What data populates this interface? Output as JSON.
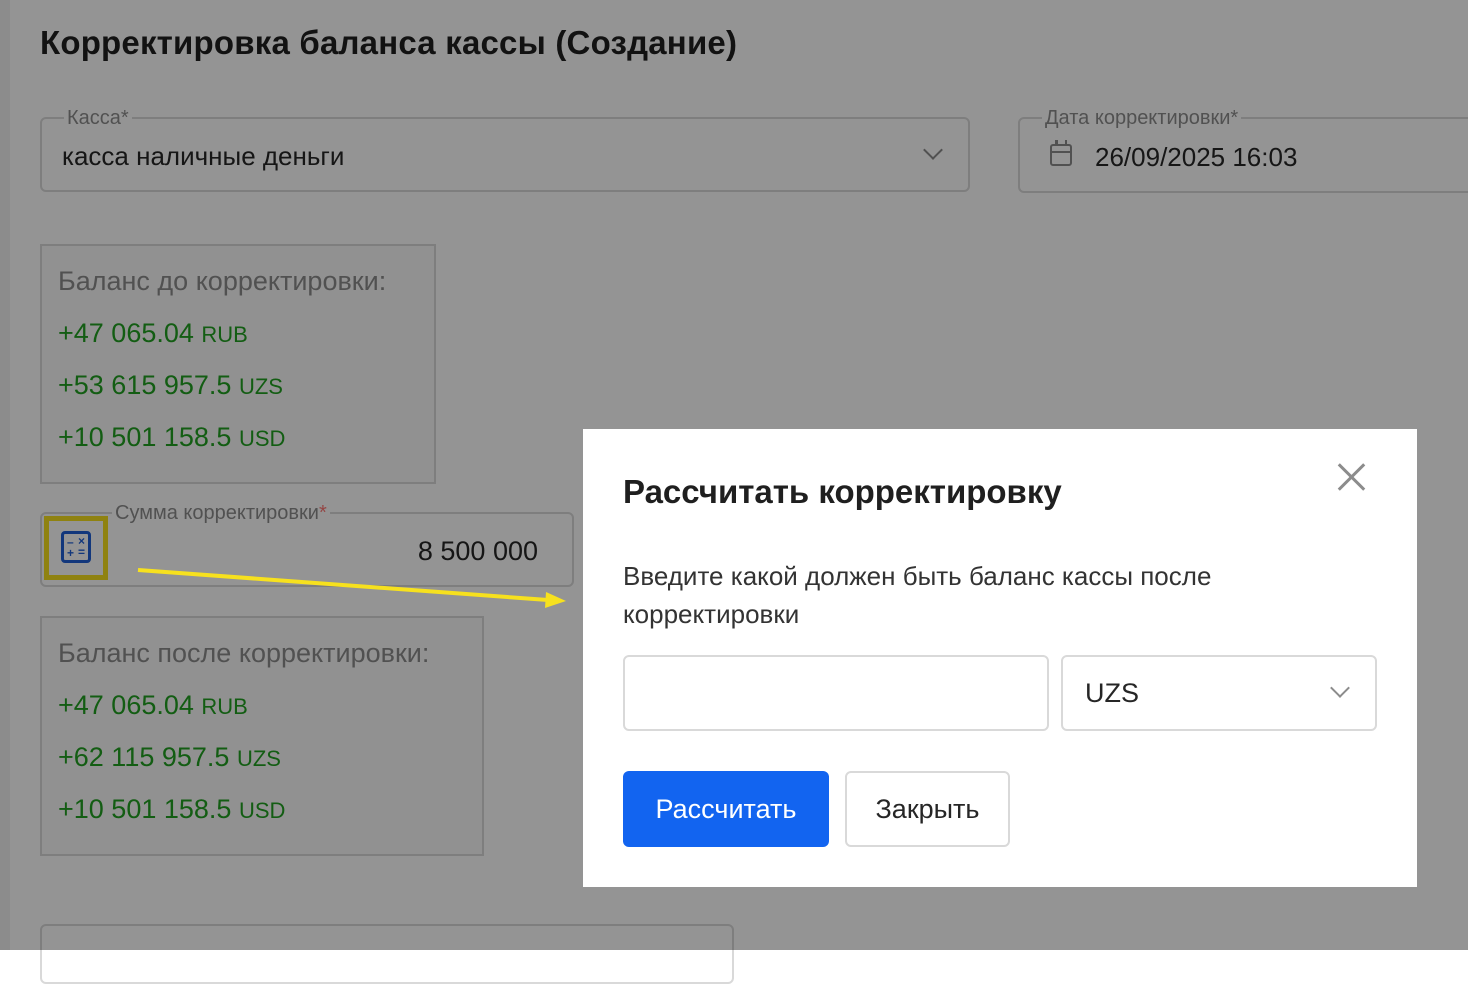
{
  "page": {
    "title": "Корректировка баланса кассы (Создание)"
  },
  "cashbox": {
    "label": "Касса",
    "required_mark": "*",
    "value": "касса наличные деньги",
    "icon": "chevron-down-icon"
  },
  "date": {
    "label": "Дата корректировки",
    "required_mark": "*",
    "value": "26/09/2025 16:03",
    "icon": "calendar-icon"
  },
  "balance_before": {
    "heading": "Баланс до корректировки:",
    "lines": [
      {
        "amount": "+47 065.04",
        "currency": "RUB"
      },
      {
        "amount": "+53 615 957.5",
        "currency": "UZS"
      },
      {
        "amount": "+10 501 158.5",
        "currency": "USD"
      }
    ]
  },
  "correction_sum": {
    "label": "Сумма корректировки",
    "required_mark": "*",
    "value": "8 500 000",
    "icon": "calculator-icon"
  },
  "balance_after": {
    "heading": "Баланс после корректировки:",
    "lines": [
      {
        "amount": "+47 065.04",
        "currency": "RUB"
      },
      {
        "amount": "+62 115 957.5",
        "currency": "UZS"
      },
      {
        "amount": "+10 501 158.5",
        "currency": "USD"
      }
    ]
  },
  "modal": {
    "title": "Рассчитать корректировку",
    "description": "Введите какой должен быть баланс кассы после корректировки",
    "input_value": "",
    "currency": "UZS",
    "calculate_label": "Рассчитать",
    "close_label": "Закрыть",
    "close_icon": "close-icon"
  },
  "colors": {
    "primary": "#1264f0",
    "positive": "#22a022",
    "highlight": "#f7e11e",
    "calculator_icon": "#1f5fd6"
  }
}
